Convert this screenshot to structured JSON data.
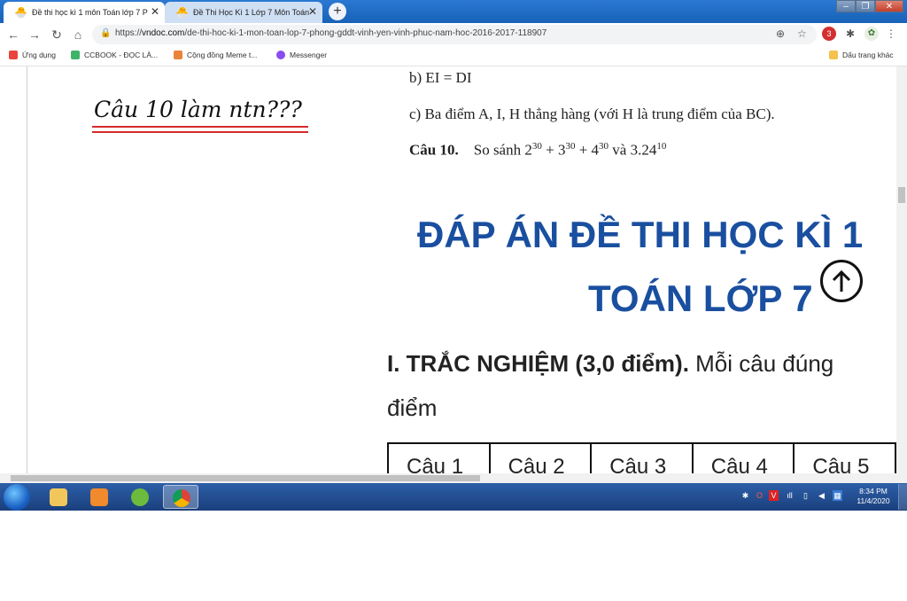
{
  "browser": {
    "tabs": [
      {
        "title": "Đề thi học kì 1 môn Toán lớp 7 P",
        "active": true
      },
      {
        "title": "Đề Thi Học Kì 1 Lớp 7 Môn Toán",
        "active": false
      }
    ],
    "new_tab_label": "+",
    "window_controls": {
      "minimize": "–",
      "maximize": "❐",
      "close": "✕"
    },
    "url_host": "vndoc.com",
    "url_prefix": "https://",
    "url_path": "/de-thi-hoc-ki-1-mon-toan-lop-7-phong-gddt-vinh-yen-vinh-phuc-nam-hoc-2016-2017-118907",
    "bookmarks": [
      {
        "label": "Ứng dụng",
        "color": "#e8453c"
      },
      {
        "label": "CCBOOK - ĐỌC LÀ...",
        "color": "#3fb36a"
      },
      {
        "label": "Cộng đồng Meme t...",
        "color": "#e9843a"
      },
      {
        "label": "Messenger",
        "color": "#8a4bf0"
      }
    ],
    "other_bookmarks": "Dấu trang khác",
    "extension_badge": "3"
  },
  "page": {
    "annotation": "Câu 10 làm ntn???",
    "line_b": "b) EI = DI",
    "line_c": "c) Ba điểm A, I, H thẳng hàng (với H là trung điểm của BC).",
    "question": {
      "label": "Câu 10.",
      "prefix": "So sánh 2",
      "e1": "30",
      "mid1": " + 3",
      "e2": "30",
      "mid2": " + 4",
      "e3": "30",
      "mid3": " và 3.24",
      "e4": "10"
    },
    "heading_line1": "ĐÁP ÁN ĐỀ THI HỌC KÌ 1",
    "heading_line2": "TOÁN LỚP 7",
    "section_bold": "I. TRẮC NGHIỆM (3,0 điểm).",
    "section_rest": " Mỗi câu đúng",
    "section_cont": "điểm",
    "table_headers": [
      "Câu 1",
      "Câu 2",
      "Câu 3",
      "Câu 4",
      "Câu 5"
    ]
  },
  "taskbar": {
    "time": "8:34 PM",
    "date": "11/4/2020"
  },
  "colors": {
    "heading": "#1a4fa0",
    "annotation_underline": "#d62a2a",
    "taskbar": "#1a3f7c"
  }
}
